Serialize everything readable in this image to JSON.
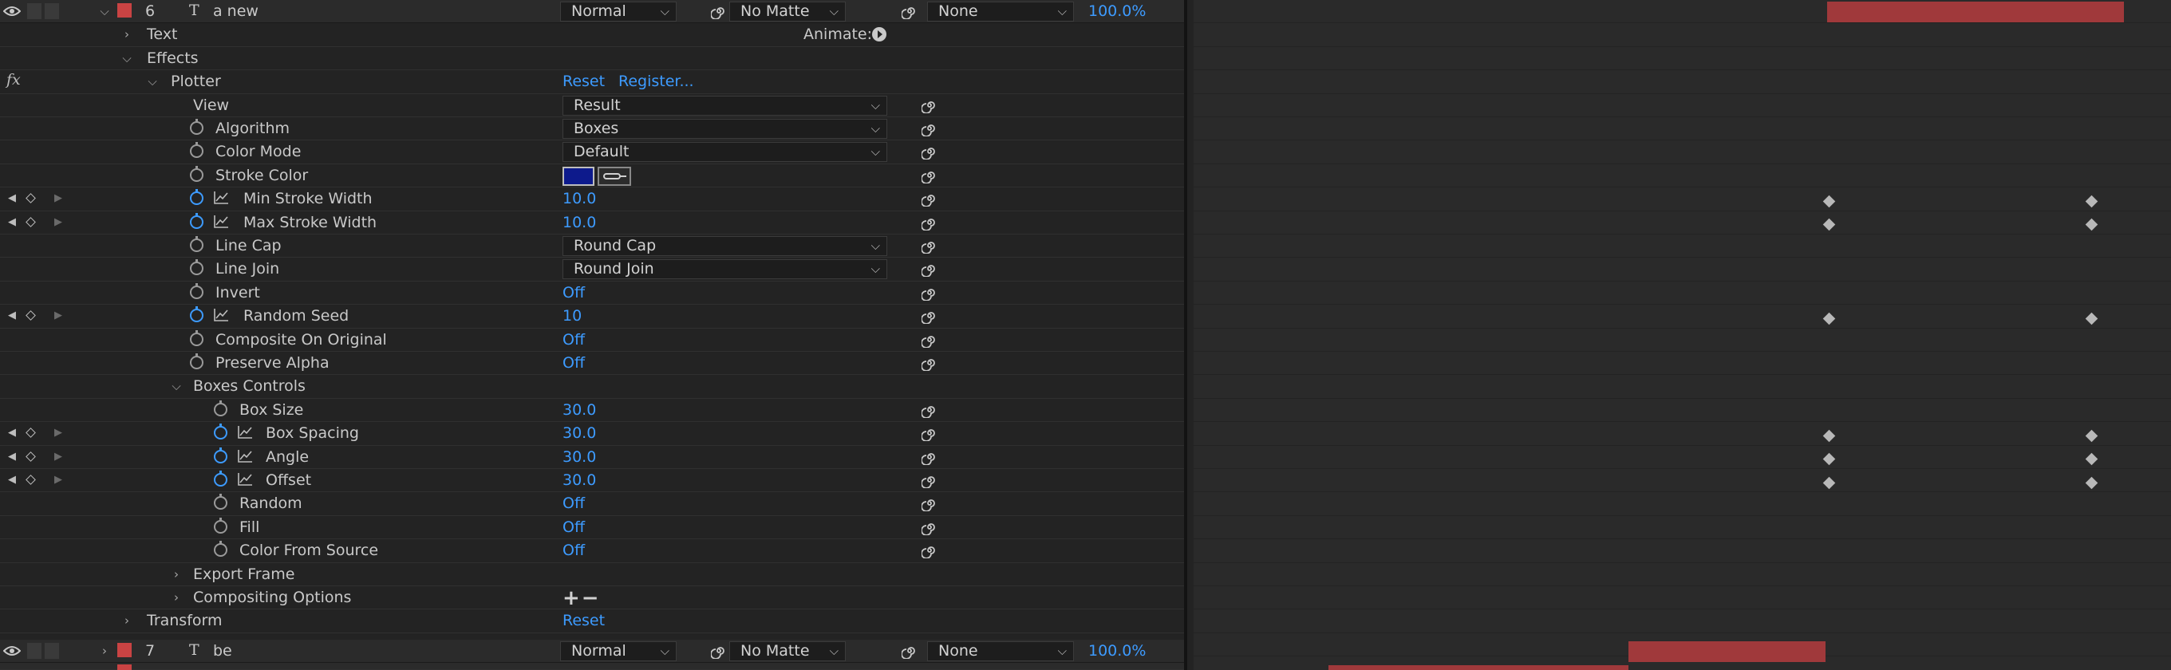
{
  "layers": [
    {
      "number": "6",
      "name": "a new",
      "mode": "Normal",
      "matte": "No Matte",
      "parent": "None",
      "opacity": "100.0%"
    },
    {
      "number": "7",
      "name": "be",
      "mode": "Normal",
      "matte": "No Matte",
      "parent": "None",
      "opacity": "100.0%"
    }
  ],
  "groups": {
    "text": "Text",
    "animate_label": "Animate:",
    "effects": "Effects",
    "fx_label": "fx",
    "plotter": "Plotter",
    "reset": "Reset",
    "register": "Register...",
    "boxes_controls": "Boxes Controls",
    "export_frame": "Export Frame",
    "compositing_options": "Compositing Options",
    "transform": "Transform",
    "transform_reset": "Reset",
    "add_remove": "+−"
  },
  "properties": {
    "view": {
      "label": "View",
      "value": "Result"
    },
    "algorithm": {
      "label": "Algorithm",
      "value": "Boxes"
    },
    "color_mode": {
      "label": "Color Mode",
      "value": "Default"
    },
    "stroke_color": {
      "label": "Stroke Color",
      "value": "#0d1a8c"
    },
    "min_stroke_width": {
      "label": "Min Stroke Width",
      "value": "10.0"
    },
    "max_stroke_width": {
      "label": "Max Stroke Width",
      "value": "10.0"
    },
    "line_cap": {
      "label": "Line Cap",
      "value": "Round Cap"
    },
    "line_join": {
      "label": "Line Join",
      "value": "Round Join"
    },
    "invert": {
      "label": "Invert",
      "value": "Off"
    },
    "random_seed": {
      "label": "Random Seed",
      "value": "10"
    },
    "composite_on_original": {
      "label": "Composite On Original",
      "value": "Off"
    },
    "preserve_alpha": {
      "label": "Preserve Alpha",
      "value": "Off"
    },
    "box_size": {
      "label": "Box Size",
      "value": "30.0"
    },
    "box_spacing": {
      "label": "Box Spacing",
      "value": "30.0"
    },
    "angle": {
      "label": "Angle",
      "value": "30.0"
    },
    "offset": {
      "label": "Offset",
      "value": "30.0"
    },
    "random": {
      "label": "Random",
      "value": "Off"
    },
    "fill": {
      "label": "Fill",
      "value": "Off"
    },
    "color_from_source": {
      "label": "Color From Source",
      "value": "Off"
    }
  },
  "colors": {
    "accent": "#3d9bff",
    "layer_label": "#c94343",
    "layer_bar": "#a0393b",
    "stroke_swatch": "#0d1a8c"
  },
  "icons": [
    "eye-icon",
    "stopwatch-icon",
    "graph-icon",
    "spiral-icon",
    "keyframe-icon",
    "eyedropper-icon",
    "animate-play-icon",
    "chevron-icon",
    "text-layer-icon"
  ]
}
